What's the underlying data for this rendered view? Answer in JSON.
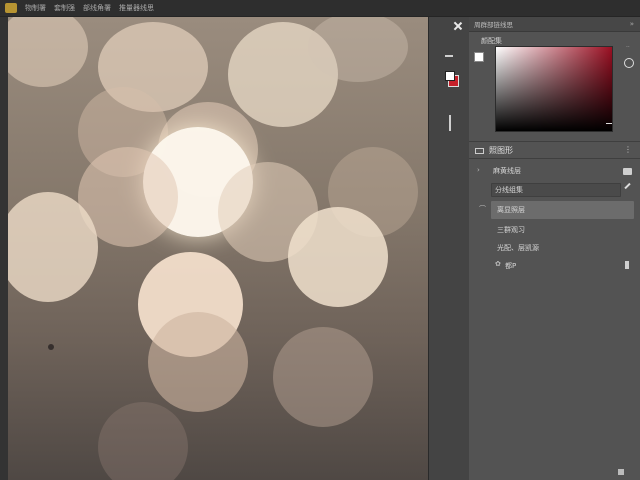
{
  "app": {
    "logo_icon": "app-logo-icon",
    "menu": [
      "物制署",
      "套制强",
      "部线角署",
      "推量器线思"
    ]
  },
  "panel": {
    "header_title": "周群部链线思",
    "header_menu_icon": "panel-menu-icon",
    "color": {
      "label": "颜配集",
      "field_colors": {
        "hue": "#9a0f22",
        "white": "#ffffff",
        "black": "#000000"
      }
    },
    "layers": {
      "title": "照图形",
      "more_icon": "⋮",
      "rows": [
        {
          "label": "麻黄线层",
          "icon": "eye-icon"
        },
        {
          "label": "分线组集"
        },
        {
          "label": "离显照层",
          "highlighted": true
        },
        {
          "label": "三群观习"
        },
        {
          "label": "光配、层凯源"
        },
        {
          "label": "都P"
        }
      ]
    }
  },
  "toolstrip": {
    "close_label": "✕"
  },
  "colors": {
    "accent": "#c6202a",
    "panel_bg": "#535353",
    "highlight": "#6c6c6c"
  }
}
